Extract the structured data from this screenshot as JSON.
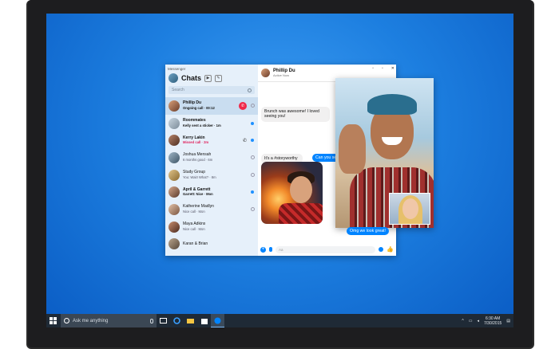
{
  "messenger": {
    "app_name": "Messenger",
    "sidebar_title": "Chats",
    "search_placeholder": "Search",
    "conversations": [
      {
        "name": "Phillip Du",
        "sub": "Ongoing call · 00:12",
        "active": true
      },
      {
        "name": "Roommates",
        "sub": "Kelly sent a sticker · 1m",
        "unread": true
      },
      {
        "name": "Kerry Lakin",
        "sub": "Missed call · 2m"
      },
      {
        "name": "Joshua Mensah",
        "sub": "6 months good · 6m"
      },
      {
        "name": "Study Group",
        "sub": "You: Wait! What? · 8m"
      },
      {
        "name": "April & Garrett",
        "sub": "Garrett: Nice · Mon",
        "unread": true
      },
      {
        "name": "Katherine Madlyn",
        "sub": "Nice call · Mon"
      },
      {
        "name": "Maya Adkins",
        "sub": "Nice call · Mon"
      },
      {
        "name": "Karan & Brian",
        "sub": ""
      }
    ],
    "chat": {
      "contact_name": "Phillip Du",
      "contact_status": "Active Now",
      "msg_in_1": "Brunch was awesome! I loved seeing you!",
      "msg_out_1": "Can you send",
      "msg_in_2": "It's a #storyworthy",
      "msg_out_2": "Omg we look great!",
      "composer_placeholder": "Aa"
    }
  },
  "taskbar": {
    "search_placeholder": "Ask me anything",
    "time": "6:30 AM",
    "date": "7/30/2015"
  },
  "colors": {
    "accent": "#0084ff",
    "end_call": "#f02849",
    "desktop": "#1d7fe0"
  }
}
